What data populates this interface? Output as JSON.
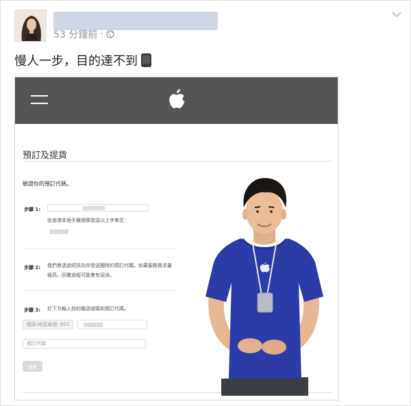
{
  "post": {
    "timestamp": "53 分鐘前",
    "privacy_icon": "globe-icon",
    "menu_icon": "chevron-down-icon",
    "text": "慢人一步，目的達不到",
    "emoji": "mobile-phone"
  },
  "screenshot": {
    "topbar_color": "#545454",
    "page_title": "預訂及提貨",
    "verify_text": "驗證你的預訂代碼。",
    "steps": [
      {
        "label": "步驟 1:",
        "text": "從香港本地手機號碼發送以上字串至："
      },
      {
        "label": "步驟 2:",
        "text_line1": "我們會透過短訊向你發送獨特的預訂代碼。如果服務需求量",
        "text_line2": "極高，回覆過程可能會有延誤。"
      },
      {
        "label": "步驟 3:",
        "text": "於下方輸入你的電話號碼和預訂代碼。",
        "phone_prefix": "國家/地區編號: 852",
        "code_placeholder": "預訂代碼"
      }
    ],
    "submit_label": "繼續"
  }
}
